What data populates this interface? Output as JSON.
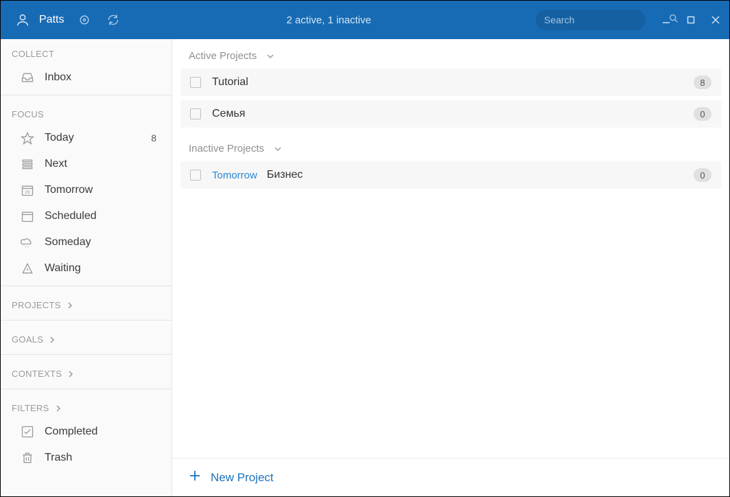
{
  "header": {
    "username": "Patts",
    "status": "2 active, 1 inactive",
    "search_placeholder": "Search"
  },
  "sidebar": {
    "sections": {
      "collect": {
        "label": "COLLECT"
      },
      "focus": {
        "label": "FOCUS"
      },
      "projects": {
        "label": "PROJECTS"
      },
      "goals": {
        "label": "GOALS"
      },
      "contexts": {
        "label": "CONTEXTS"
      },
      "filters": {
        "label": "FILTERS"
      }
    },
    "collect_items": [
      {
        "label": "Inbox"
      }
    ],
    "focus_items": [
      {
        "label": "Today",
        "count": "8"
      },
      {
        "label": "Next"
      },
      {
        "label": "Tomorrow"
      },
      {
        "label": "Scheduled"
      },
      {
        "label": "Someday"
      },
      {
        "label": "Waiting"
      }
    ],
    "filter_items": [
      {
        "label": "Completed"
      },
      {
        "label": "Trash"
      }
    ]
  },
  "main": {
    "groups": {
      "active": {
        "label": "Active Projects"
      },
      "inactive": {
        "label": "Inactive Projects"
      }
    },
    "active_projects": [
      {
        "title": "Tutorial",
        "badge": "8"
      },
      {
        "title": "Семья",
        "badge": "0"
      }
    ],
    "inactive_projects": [
      {
        "tag": "Tomorrow",
        "title": "Бизнес",
        "badge": "0"
      }
    ],
    "footer_label": "New Project"
  }
}
